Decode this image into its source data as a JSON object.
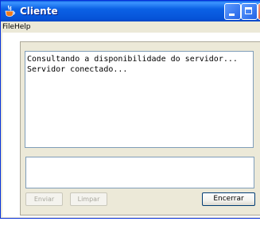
{
  "window": {
    "title": "Cliente"
  },
  "menu": {
    "items": [
      "File",
      "Help"
    ]
  },
  "log": {
    "lines": [
      "Consultando a disponibilidade do servidor...",
      "Servidor conectado..."
    ]
  },
  "input": {
    "value": ""
  },
  "buttons": {
    "send": {
      "label": "Enviar",
      "enabled": false
    },
    "clear": {
      "label": "Limpar",
      "enabled": false
    },
    "close": {
      "label": "Encerrar",
      "enabled": true
    }
  },
  "colors": {
    "titlebar": "#0a5bde",
    "window_bg": "#ece9d8",
    "field_border": "#7f9db9"
  },
  "icons": {
    "app": "java-cup-icon",
    "minimize": "minimize-icon",
    "maximize": "maximize-icon",
    "close": "close-icon"
  }
}
